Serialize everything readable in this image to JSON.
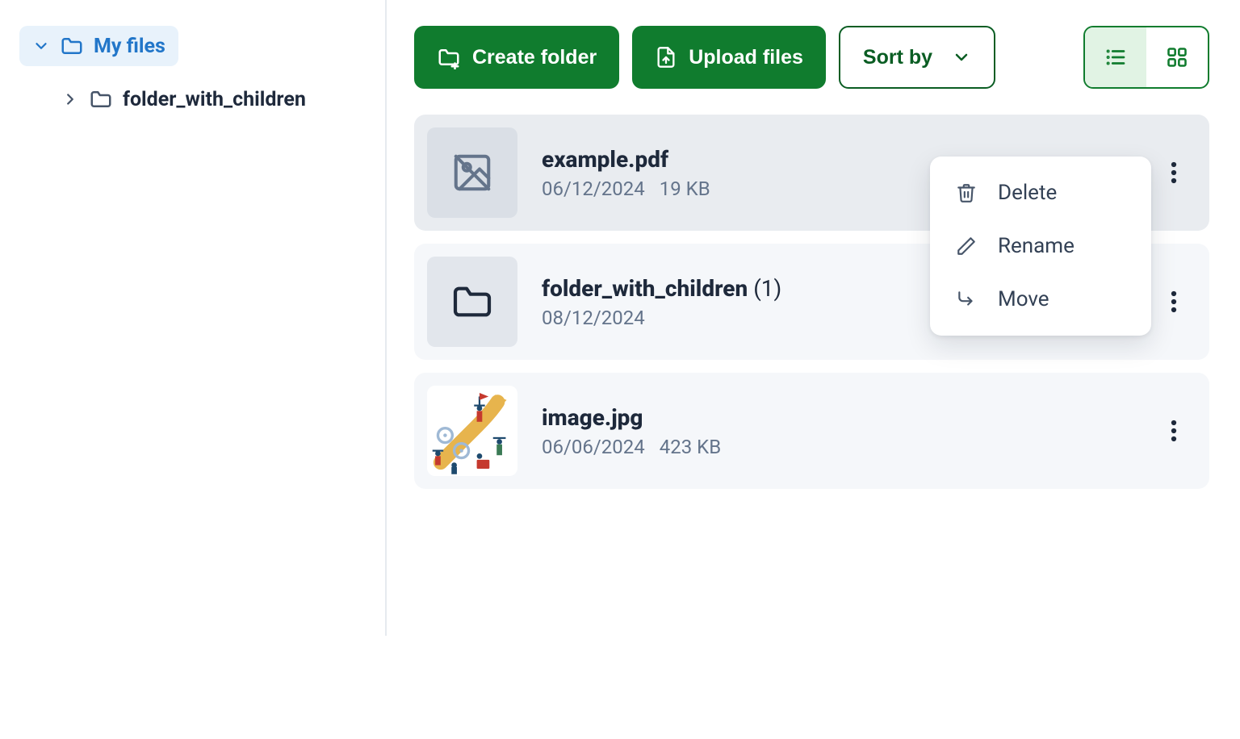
{
  "colors": {
    "brand_green": "#107c2e",
    "brand_blue": "#2276c9",
    "text_primary": "#1e293b",
    "text_muted": "#64748b",
    "row_bg": "#f5f7fa",
    "row_selected": "#e9ecf0"
  },
  "sidebar": {
    "root_label": "My files",
    "children": [
      {
        "label": "folder_with_children"
      }
    ]
  },
  "toolbar": {
    "create_folder": "Create folder",
    "upload_files": "Upload files",
    "sort_by": "Sort by"
  },
  "view": {
    "active": "list"
  },
  "files": [
    {
      "type": "file",
      "thumb": "broken-image",
      "name": "example.pdf",
      "date": "06/12/2024",
      "size": "19 KB",
      "selected": true
    },
    {
      "type": "folder",
      "thumb": "folder",
      "name": "folder_with_children",
      "count": "(1)",
      "date": "08/12/2024",
      "size": ""
    },
    {
      "type": "file",
      "thumb": "illustration",
      "name": "image.jpg",
      "date": "06/06/2024",
      "size": "423 KB"
    }
  ],
  "context_menu": {
    "open_on_index": 0,
    "items": [
      {
        "icon": "trash",
        "label": "Delete"
      },
      {
        "icon": "pencil",
        "label": "Rename"
      },
      {
        "icon": "move",
        "label": "Move"
      }
    ]
  }
}
